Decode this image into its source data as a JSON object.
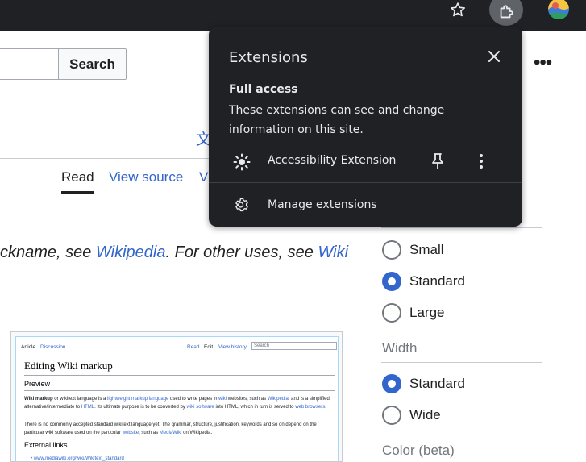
{
  "browser": {
    "bookmark_icon": "star-outline-icon",
    "extensions_icon": "puzzle-piece-icon",
    "profile_icon": "avatar"
  },
  "page": {
    "search_button_label": "Search",
    "more_menu_glyph": "•••",
    "language_glyph": "文",
    "tabs": {
      "read": "Read",
      "view_source": "View source",
      "truncated": "V"
    },
    "hatnote": {
      "prefix": "ckname, see ",
      "link1": "Wikipedia",
      "middle": ". For other uses, see ",
      "link2": "Wiki"
    },
    "thumbnail": {
      "tab_article": "Article",
      "tab_discussion": "Discussion",
      "tab_read": "Read",
      "tab_edit": "Edit",
      "tab_history": "View history",
      "search_placeholder": "Search",
      "title": "Editing Wiki markup",
      "h_preview": "Preview",
      "para1_a": "Wiki markup",
      "para1_b": " or wikitext language is a ",
      "para1_c": "lightweight markup language",
      "para1_d": " used to write pages in ",
      "para1_e": "wiki",
      "para1_f": " websites, such as ",
      "para1_g": "Wikipedia",
      "para1_h": ", and is a simplified alternative/intermediate to ",
      "para1_i": "HTML",
      "para1_j": ". Its ultimate purpose is to be converted by ",
      "para1_k": "wiki software",
      "para1_l": " into HTML, which in turn is served to ",
      "para1_m": "web browsers",
      "para1_n": ".",
      "para2_a": "There is no commonly accepted standard wikitext language yet. The grammar, structure, justification, keywords and so on depend on the particular wiki software used on the particular ",
      "para2_b": "website",
      "para2_c": ", such as ",
      "para2_d": "MediaWiki",
      "para2_e": " on Wikipedia.",
      "h_external": "External links",
      "ext_link": "www.mediawiki.org/wiki/Wikitext_standard"
    },
    "sidebar": {
      "text_options": [
        "Small",
        "Standard",
        "Large"
      ],
      "text_selected": "Standard",
      "width_heading": "Width",
      "width_options": [
        "Standard",
        "Wide"
      ],
      "width_selected": "Standard",
      "color_heading": "Color (beta)"
    }
  },
  "extensions_popup": {
    "title": "Extensions",
    "close_icon": "close-icon",
    "full_access_heading": "Full access",
    "full_access_description": "These extensions can see and change information on this site.",
    "extensions": [
      {
        "name": "Accessibility Extension",
        "icon": "sun-icon",
        "pinned": false
      }
    ],
    "manage_label": "Manage extensions",
    "manage_icon": "gear-icon"
  },
  "colors": {
    "popup_bg": "#202124",
    "popup_text": "#e8eaed",
    "link": "#3366cc",
    "radio_selected": "#3366cc",
    "topbar": "#202124"
  }
}
